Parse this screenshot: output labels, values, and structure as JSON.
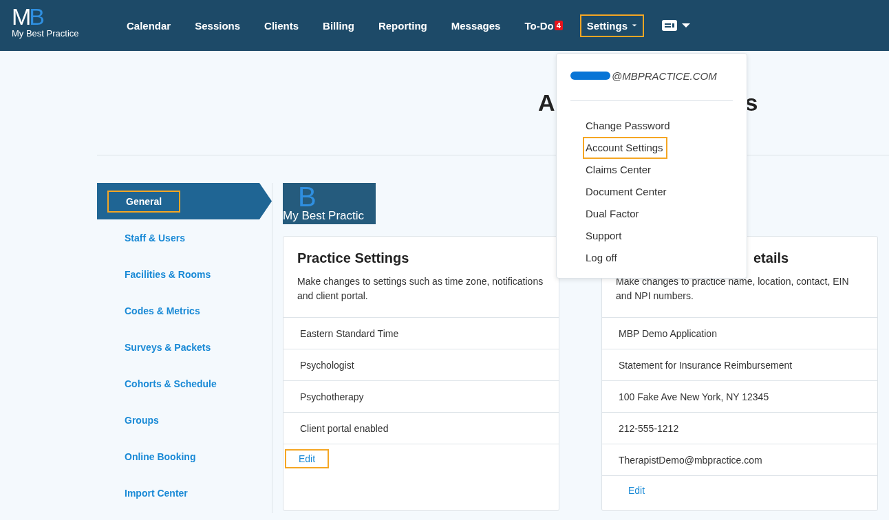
{
  "logo": {
    "mark_left": "M",
    "mark_right": "B",
    "name": "My Best Practice"
  },
  "nav": [
    {
      "label": "Calendar",
      "highlighted": false
    },
    {
      "label": "Sessions",
      "highlighted": false
    },
    {
      "label": "Clients",
      "highlighted": false
    },
    {
      "label": "Billing",
      "highlighted": false
    },
    {
      "label": "Reporting",
      "highlighted": false
    },
    {
      "label": "Messages",
      "highlighted": false
    },
    {
      "label": "To-Do",
      "badge": "4",
      "highlighted": false
    },
    {
      "label": "Settings",
      "dropdown": true,
      "highlighted": true
    }
  ],
  "page_heading": {
    "visible_start": "A",
    "visible_end": "s"
  },
  "sidebar": [
    {
      "label": "General",
      "selected": true,
      "highlighted": true
    },
    {
      "label": "Staff & Users",
      "selected": false,
      "highlighted": false
    },
    {
      "label": "Facilities & Rooms",
      "selected": false,
      "highlighted": false
    },
    {
      "label": "Codes & Metrics",
      "selected": false,
      "highlighted": false
    },
    {
      "label": "Surveys & Packets",
      "selected": false,
      "highlighted": false
    },
    {
      "label": "Cohorts & Schedule",
      "selected": false,
      "highlighted": false
    },
    {
      "label": "Groups",
      "selected": false,
      "highlighted": false
    },
    {
      "label": "Online Booking",
      "selected": false,
      "highlighted": false
    },
    {
      "label": "Import Center",
      "selected": false,
      "highlighted": false
    }
  ],
  "practice_logo": {
    "mark_right": "B",
    "name": "My Best Practic"
  },
  "cards": [
    {
      "title": "Practice Settings",
      "description": "Make changes to settings such as time zone, notifications and client portal.",
      "rows": [
        "Eastern Standard Time",
        "Psychologist",
        "Psychotherapy",
        "Client portal enabled"
      ],
      "edit": {
        "label": "Edit",
        "highlighted": true
      }
    },
    {
      "title": "etails",
      "description": "Make changes to practice name, location, contact, EIN and NPI numbers.",
      "rows": [
        "MBP Demo Application",
        "Statement for Insurance Reimbursement",
        "100 Fake Ave New York, NY 12345",
        "212-555-1212",
        "TherapistDemo@mbpractice.com"
      ],
      "edit": {
        "label": "Edit",
        "highlighted": false
      }
    }
  ],
  "user_menu": {
    "email": "@MBPRACTICE.COM",
    "items": [
      {
        "label": "Change Password",
        "highlighted": false
      },
      {
        "label": "Account Settings",
        "highlighted": true
      },
      {
        "label": "Claims Center",
        "highlighted": false
      },
      {
        "label": "Document Center",
        "highlighted": false
      },
      {
        "label": "Dual Factor",
        "highlighted": false
      },
      {
        "label": "Support",
        "highlighted": false
      },
      {
        "label": "Log off",
        "highlighted": false
      }
    ]
  }
}
